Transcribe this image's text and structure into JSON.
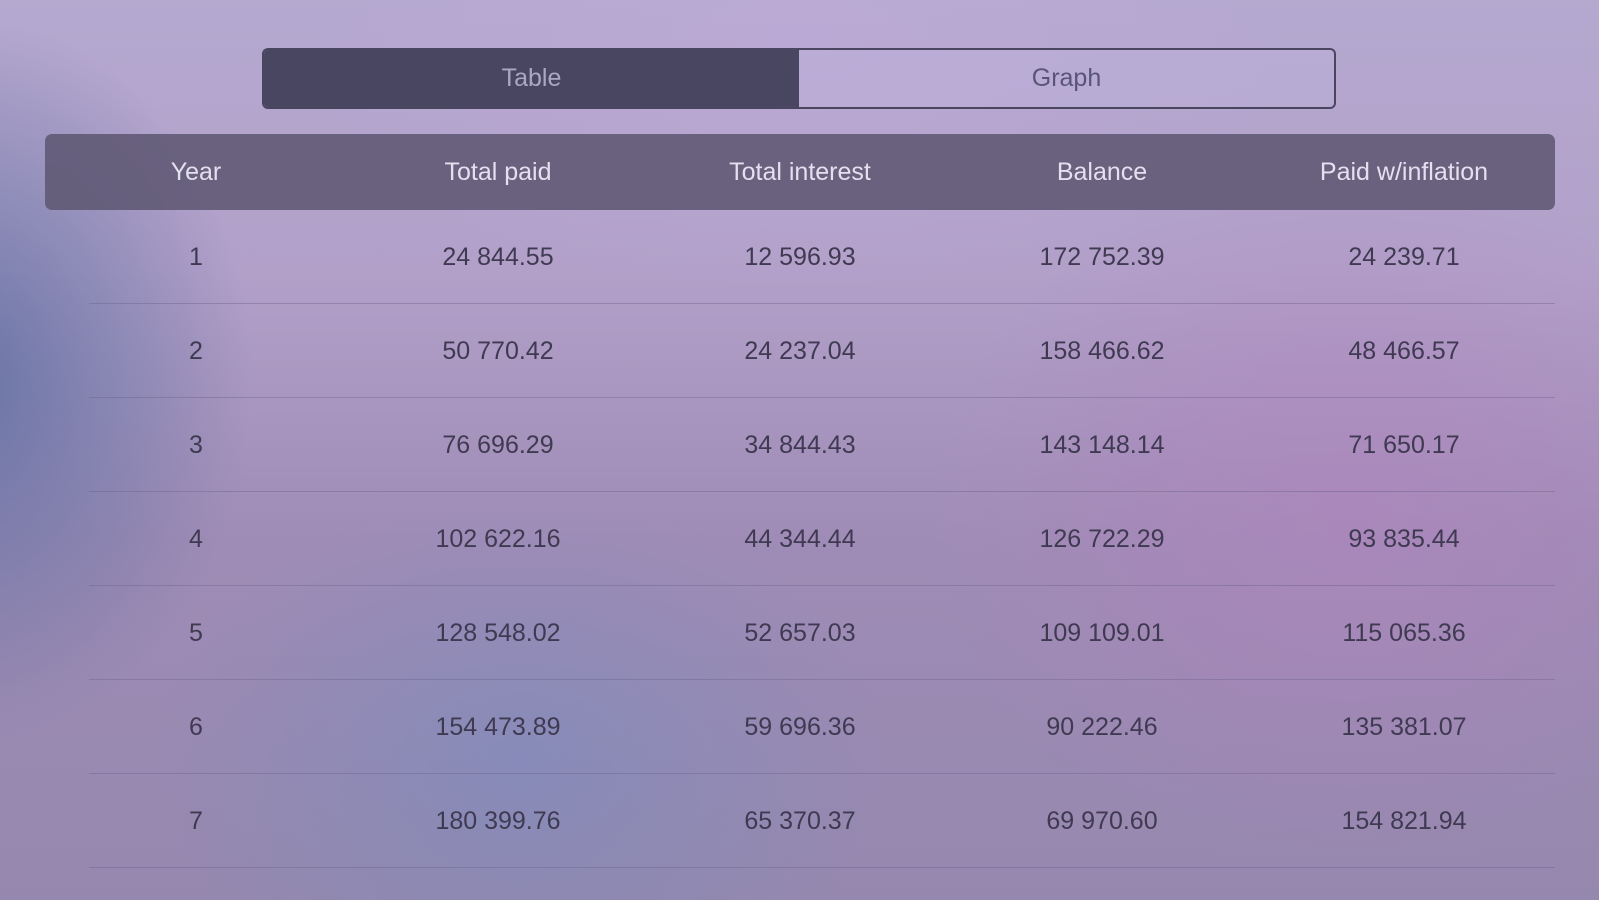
{
  "tabs": {
    "table_label": "Table",
    "graph_label": "Graph"
  },
  "columns": [
    "Year",
    "Total paid",
    "Total interest",
    "Balance",
    "Paid w/inflation"
  ],
  "rows": [
    [
      "1",
      "24 844.55",
      "12 596.93",
      "172 752.39",
      "24 239.71"
    ],
    [
      "2",
      "50 770.42",
      "24 237.04",
      "158 466.62",
      "48 466.57"
    ],
    [
      "3",
      "76 696.29",
      "34 844.43",
      "143 148.14",
      "71 650.17"
    ],
    [
      "4",
      "102 622.16",
      "44 344.44",
      "126 722.29",
      "93 835.44"
    ],
    [
      "5",
      "128 548.02",
      "52 657.03",
      "109 109.01",
      "115 065.36"
    ],
    [
      "6",
      "154 473.89",
      "59 696.36",
      "90 222.46",
      "135 381.07"
    ],
    [
      "7",
      "180 399.76",
      "65 370.37",
      "69 970.60",
      "154 821.94"
    ]
  ],
  "colors": {
    "active_tab": "#494662",
    "header_bg": "#5f5873",
    "text_dark": "#3f3a52"
  }
}
